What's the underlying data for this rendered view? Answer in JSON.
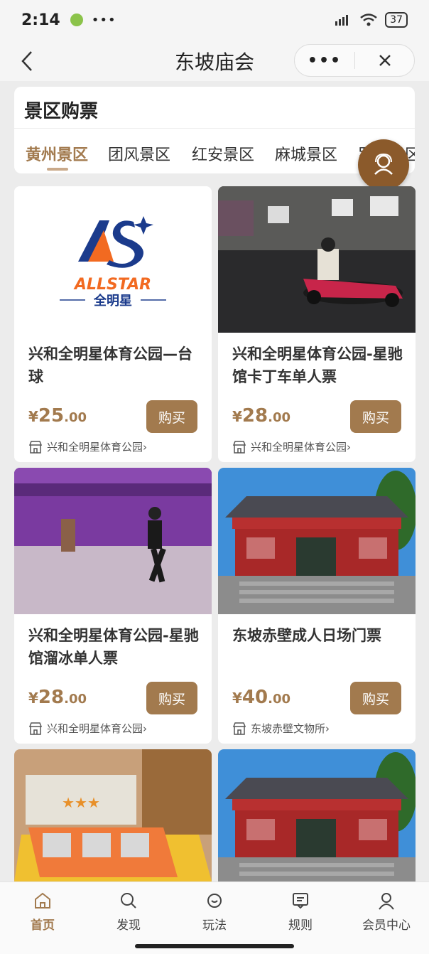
{
  "status_bar": {
    "time": "2:14",
    "dots": "•••",
    "battery": "37"
  },
  "nav": {
    "title": "东坡庙会",
    "more": "•••"
  },
  "section": {
    "title": "景区购票",
    "tabs": [
      "黄州景区",
      "团风景区",
      "红安景区",
      "麻城景区",
      "罗田景区"
    ]
  },
  "products": [
    {
      "title": "兴和全明星体育公园—台球",
      "currency": "¥",
      "price_int": "25",
      "price_dec": ".00",
      "buy": "购买",
      "shop": "兴和全明星体育公园",
      "logo_text": "ALLSTAR",
      "logo_sub": "全明星"
    },
    {
      "title": "兴和全明星体育公园-星驰馆卡丁车单人票",
      "currency": "¥",
      "price_int": "28",
      "price_dec": ".00",
      "buy": "购买",
      "shop": "兴和全明星体育公园"
    },
    {
      "title": "兴和全明星体育公园-星驰馆溜冰单人票",
      "currency": "¥",
      "price_int": "28",
      "price_dec": ".00",
      "buy": "购买",
      "shop": "兴和全明星体育公园"
    },
    {
      "title": "东坡赤壁成人日场门票",
      "currency": "¥",
      "price_int": "40",
      "price_dec": ".00",
      "buy": "购买",
      "shop": "东坡赤壁文物所"
    }
  ],
  "bottom_nav": [
    {
      "label": "首页",
      "icon": "home-icon",
      "active": true
    },
    {
      "label": "发现",
      "icon": "search-icon"
    },
    {
      "label": "玩法",
      "icon": "chat-icon"
    },
    {
      "label": "规则",
      "icon": "rules-icon"
    },
    {
      "label": "会员中心",
      "icon": "user-icon"
    }
  ],
  "colors": {
    "accent": "#a27a4e",
    "float": "#8b5a2b",
    "background": "#ececec"
  }
}
